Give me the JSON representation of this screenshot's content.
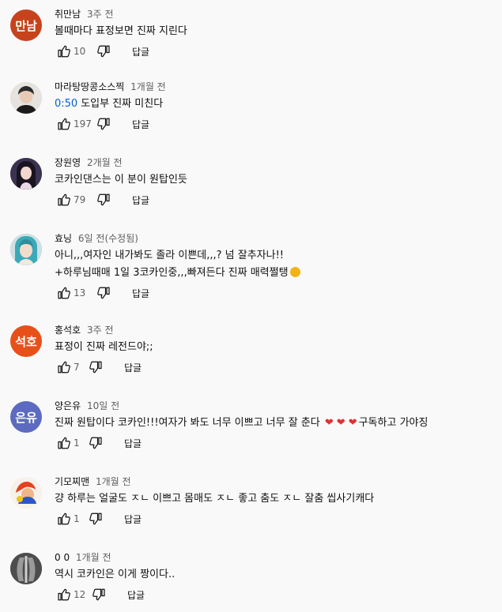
{
  "comments": [
    {
      "author": "취만남",
      "time": "3주 전",
      "text_parts": [
        {
          "type": "text",
          "value": "볼때마다 표정보면 진짜 지린다"
        }
      ],
      "text_line2": "",
      "likes": "10",
      "reply_label": "답글",
      "avatar": {
        "kind": "initials",
        "text": "만남",
        "color": "#c6431b"
      }
    },
    {
      "author": "마라탕땅콩소스찍",
      "time": "1개월 전",
      "timestamp": "0:50",
      "text": "도입부 진짜 미친다",
      "text_line2": "",
      "likes": "197",
      "reply_label": "답글",
      "avatar": {
        "kind": "photo",
        "icon": "person-photo",
        "color": "#d9d2cc"
      }
    },
    {
      "author": "장원영",
      "time": "2개월 전",
      "text": "코카인댄스는 이 분이 원탑인듯",
      "text_line2": "",
      "likes": "79",
      "reply_label": "답글",
      "avatar": {
        "kind": "photo",
        "icon": "person-photo",
        "color": "#4a3a5a"
      }
    },
    {
      "author": "효닝",
      "time": "6일 전(수정됨)",
      "text": "아니,,,여자인 내가봐도 졸라 이쁜데,,,? 넘 잘추자나!!",
      "text_line2": "+하루님때매 1일 3코카인중,,,빠져든다 진짜 매력쩔탱",
      "likes": "13",
      "reply_label": "답글",
      "avatar": {
        "kind": "photo",
        "icon": "person-photo",
        "color": "#6fa8b5"
      }
    },
    {
      "author": "홍석호",
      "time": "3주 전",
      "text": "표정이 진짜 레전드야;;",
      "text_line2": "",
      "likes": "7",
      "reply_label": "답글",
      "avatar": {
        "kind": "initials",
        "text": "석호",
        "color": "#e8501a"
      }
    },
    {
      "author": "양은유",
      "time": "10일 전",
      "text": "진짜 원탑이다 코카인!!!여자가 봐도 너무 이쁘고 너무 잘 춘다",
      "text_suffix": "구독하고 가야징",
      "text_line2": "",
      "likes": "1",
      "reply_label": "답글",
      "avatar": {
        "kind": "initials",
        "text": "은유",
        "color": "#5c6bc0"
      }
    },
    {
      "author": "기모찌맨",
      "time": "1개월 전",
      "text": "걍 하루는 얼굴도 ㅈㄴ 이쁘고 몸매도 ㅈㄴ 좋고 춤도 ㅈㄴ 잘춤 씹사기캐다",
      "text_line2": "",
      "likes": "1",
      "reply_label": "답글",
      "avatar": {
        "kind": "photo",
        "icon": "character-photo",
        "color": "#f4f0ea"
      }
    },
    {
      "author": "0 0",
      "time": "1개월 전",
      "text": "역시 코카인은 이게 짱이다..",
      "text_line2": "",
      "likes": "12",
      "reply_label": "답글",
      "avatar": {
        "kind": "photo",
        "icon": "xray-photo",
        "color": "#6a6a6a"
      }
    }
  ]
}
